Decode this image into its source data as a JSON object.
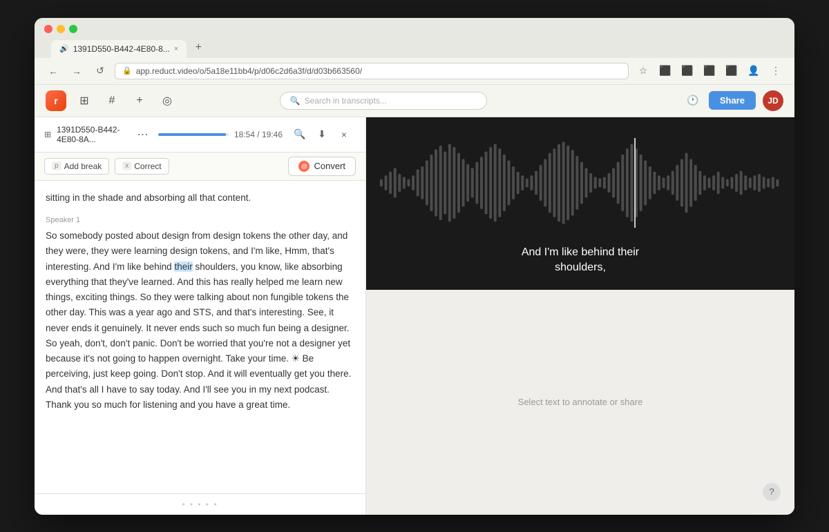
{
  "browser": {
    "tab_title": "1391D550-B442-4E80-8...",
    "tab_audio_icon": "🔊",
    "tab_close": "×",
    "tab_new": "+",
    "url": "app.reduct.video/o/5a18e11bb4/p/d06c2d6a3f/d/d03b663560/",
    "url_lock_icon": "🔒"
  },
  "nav": {
    "back_title": "←",
    "forward_title": "→",
    "reload_title": "↺",
    "bookmark_title": "☆",
    "extensions1": "⊞",
    "extensions2": "☰",
    "chevron_title": "⌄"
  },
  "toolbar": {
    "logo": "r",
    "icon_people": "⊞",
    "icon_hash": "#",
    "icon_plus": "+",
    "icon_search_circle": "◎",
    "search_placeholder": "Search in transcripts...",
    "history_icon": "🕐",
    "share_label": "Share",
    "avatar_initials": "JD"
  },
  "transcript": {
    "header": {
      "icon": "⊞",
      "title": "1391D550-B442-4E80-8A...",
      "more_btn": "⋯",
      "progress_pct": 96,
      "timestamp": "18:54 / 19:46",
      "search_icon": "🔍",
      "download_icon": "⬇",
      "close_icon": "×"
    },
    "edit_toolbar": {
      "add_break_kbd": "p",
      "add_break_label": "Add break",
      "correct_kbd": "x",
      "correct_label": "Correct",
      "convert_icon": "@",
      "convert_label": "Convert"
    },
    "text_top": "sitting in the shade and absorbing all that content.",
    "speaker": "Speaker 1",
    "main_text": "So somebody posted about design from design tokens the other day, and they were, they were learning design tokens, and I'm like, Hmm, that's interesting. And I'm like behind their shoulders, you know, like absorbing everything that they've learned. And this has really helped me learn new things, exciting things. So they were talking about non fungible tokens the other day. This was a year ago and STS, and that's interesting. See, it never ends it genuinely. It never ends such so much fun being a designer. So yeah, don't, don't panic. Don't be worried that you're not a designer yet because it's not going to happen overnight. Take your time. ☀ Be perceiving, just keep going. Don't stop. And it will eventually get you there. And that's all I have to say today. And I'll see you in my next podcast. Thank you so much for listening and you have a great time.",
    "highlight_word": "their",
    "footer_dots": "• • • • •"
  },
  "video": {
    "subtitle_line1": "And I'm like behind their",
    "subtitle_line2": "shoulders,"
  },
  "annotation": {
    "hint": "Select text to annotate or share"
  },
  "help": {
    "label": "?"
  }
}
